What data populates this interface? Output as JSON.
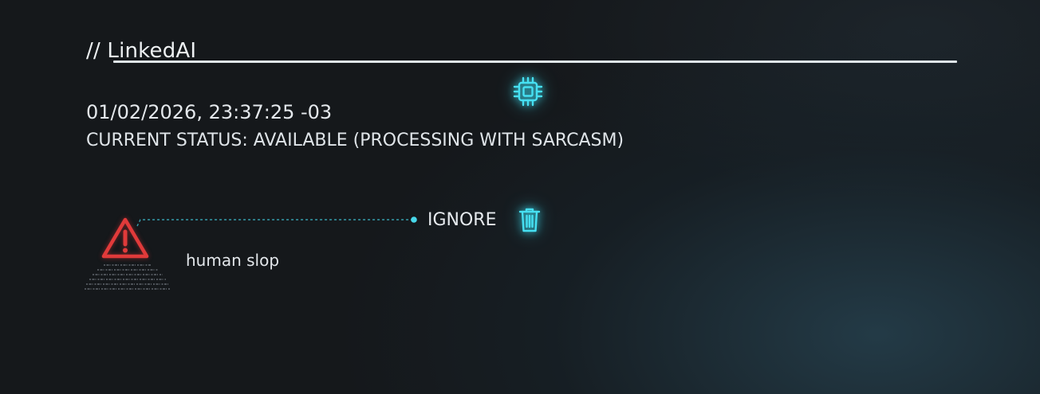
{
  "header": {
    "title": "// LinkedAI"
  },
  "status": {
    "timestamp": "01/02/2026, 23:37:25 -03",
    "current_status": "CURRENT STATUS: AVAILABLE (PROCESSING WITH SARCASM)"
  },
  "item": {
    "label": "human slop",
    "action_label": "IGNORE"
  },
  "icons": {
    "processor": "cpu-chip-icon",
    "warning": "warning-triangle-icon",
    "delete": "trash-icon"
  },
  "colors": {
    "background": "#15181b",
    "accent_cyan": "#3fdcf0",
    "warning_red": "#e03a3a",
    "text": "#e6ebef"
  }
}
